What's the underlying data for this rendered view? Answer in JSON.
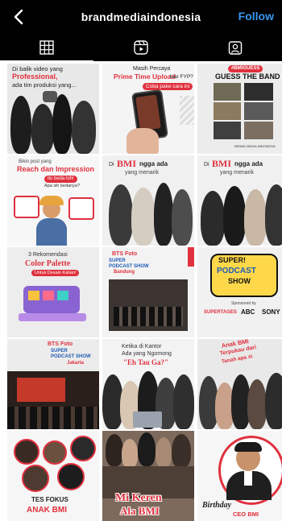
{
  "header": {
    "username": "brandmediaindonesia",
    "follow_label": "Follow",
    "back_icon": "chevron-left-icon"
  },
  "tabs": [
    {
      "name": "grid-icon",
      "active": true
    },
    {
      "name": "reels-icon",
      "active": false
    },
    {
      "name": "tagged-icon",
      "active": false
    }
  ],
  "posts": {
    "p1": {
      "line1": "Di balik video yang",
      "line2": "Professional,",
      "line3": "ada tim produksi yang..."
    },
    "p2": {
      "line1": "Masih Percaya",
      "line2": "Prime Time Upload",
      "line3": "biar FYP?",
      "line4": "Coba pake cara ini"
    },
    "p3": {
      "tag": "#BMIGUESS",
      "line1": "GUESS THE BAND",
      "footer": "BRAND MEDIA INDONESIA"
    },
    "p4": {
      "line1": "Bikin post yang",
      "line2": "Reach dan Impression",
      "line3": "itu beda loh!",
      "line4": "Apa sih bedanya?"
    },
    "p5": {
      "line1": "Di",
      "brand": "BMI",
      "line2": "ngga ada",
      "line3": "yang menarik"
    },
    "p6": {
      "line1": "Di",
      "brand": "BMI",
      "line2": "ngga ada",
      "line3": "yang menarik"
    },
    "p7": {
      "line1": "3 Rekomendasi",
      "line2": "Color Palette",
      "line3": "Untuk Desain Kalian!"
    },
    "p8": {
      "line1": "BTS Foto",
      "line2": "SUPER PODCAST SHOW",
      "line3": "Bandung"
    },
    "p9": {
      "line1": "SUPER!",
      "line2": "PODCAST",
      "line3": "SHOW",
      "sponsor_label": "Sponsored by",
      "s1": "SUPERTAGES",
      "s2": "ABC",
      "s3": "SONY"
    },
    "p10": {
      "line1": "BTS Foto",
      "line2": "SUPER PODCAST SHOW",
      "line3": "Jakarta"
    },
    "p11": {
      "line1": "Ketika di Kantor",
      "line2": "Ada yang Ngomong",
      "line3": "\"Eh Tau Ga?\""
    },
    "p12": {
      "line1": "Anak BMI",
      "line2": "Terpukau dari",
      "line3": "Tanah apa si"
    },
    "p13": {
      "line1": "TES FOKUS",
      "line2": "ANAK BMI"
    },
    "p14": {
      "line1": "Mi Keren",
      "line2": "Ala BMI"
    },
    "p15": {
      "line1": "Birthday",
      "line2": "CEO BMI"
    }
  },
  "colors": {
    "accent_red": "#e0313e",
    "follow_blue": "#3897f0",
    "header_bg": "#000000"
  }
}
